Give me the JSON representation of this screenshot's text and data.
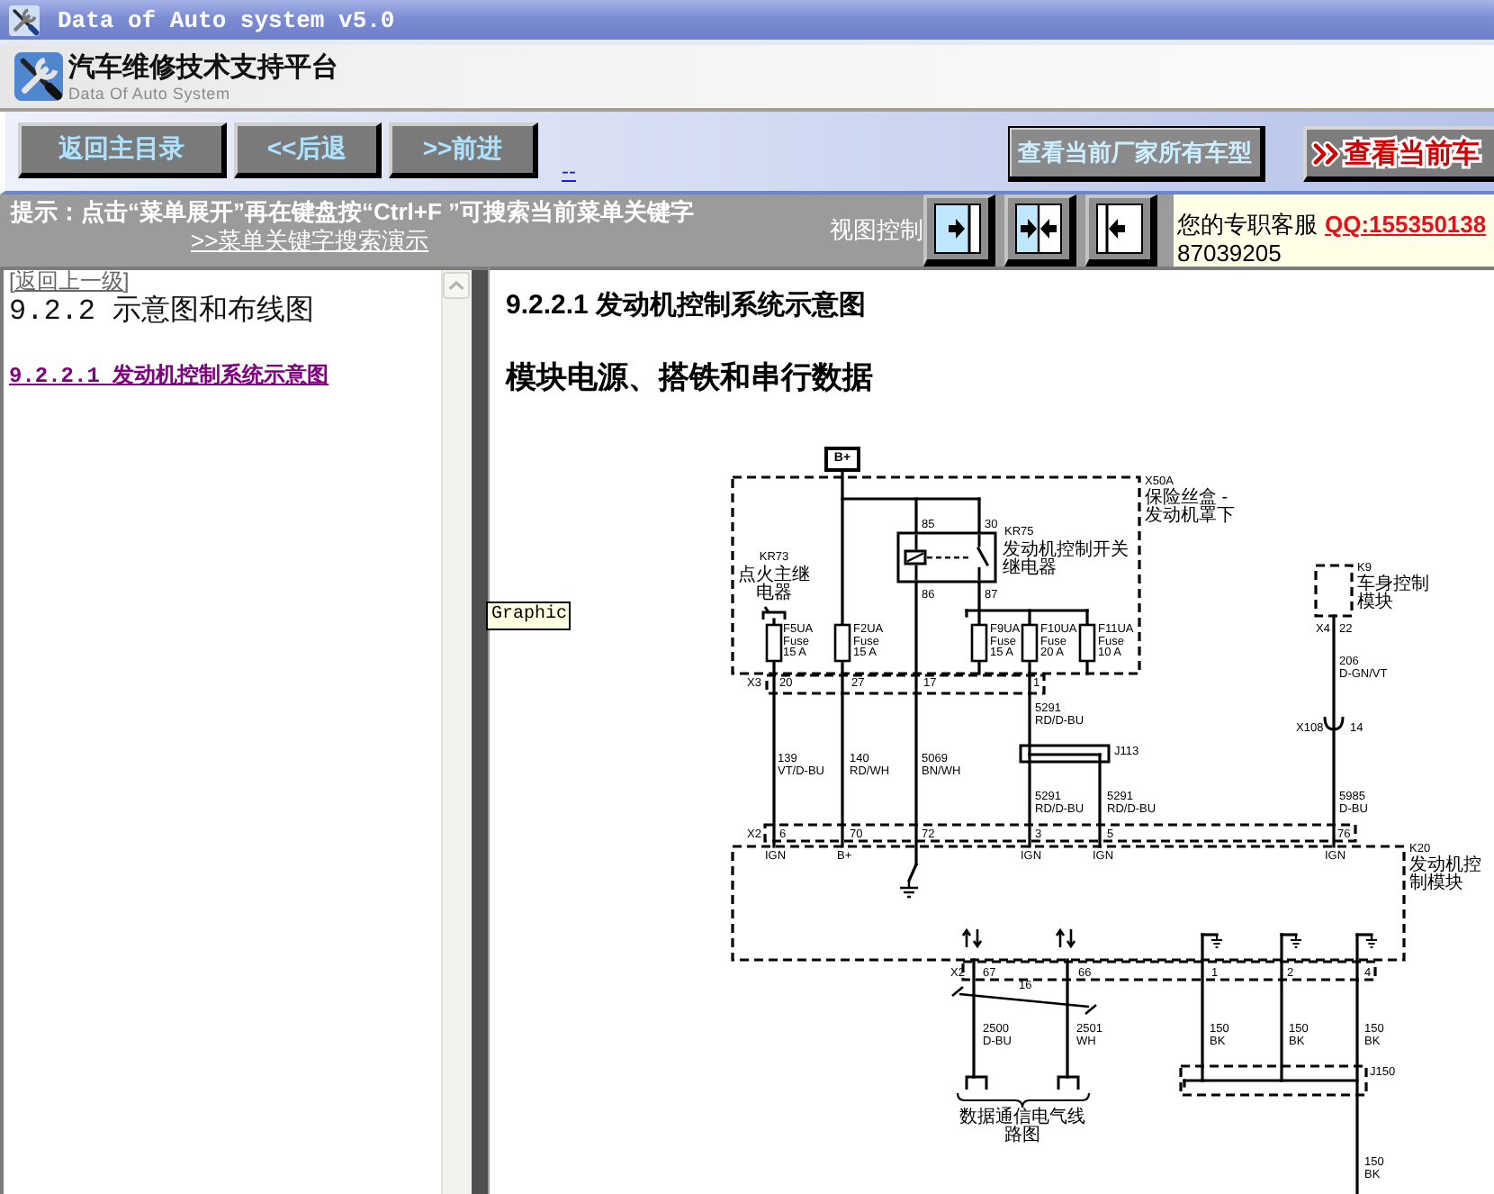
{
  "window": {
    "title": "Data of Auto system v5.0"
  },
  "header": {
    "title": "汽车维修技术支持平台",
    "subtitle": "Data Of Auto System"
  },
  "toolbar": {
    "buttons": [
      "返回主目录",
      "<<后退",
      ">>前进"
    ],
    "link": "--",
    "catalog_buttons": [
      {
        "label": "查看当前厂家所有车型",
        "kind": "plain"
      },
      {
        "label": "查看当前车",
        "kind": "highlight"
      }
    ]
  },
  "hint_bar": {
    "tip": "提示：点击“菜单展开”再在键盘按“Ctrl+F ”可搜索当前菜单关键字",
    "demo_link": ">>菜单关键字搜索演示",
    "view_label": "视图控制",
    "view_buttons": [
      {
        "kind": "right"
      },
      {
        "kind": "inward"
      },
      {
        "kind": "left"
      }
    ],
    "service_label": "您的专职客服",
    "qq": "QQ:155350138",
    "phone": "87039205"
  },
  "sidebar": {
    "back_link": "[返回上一级]",
    "heading": "9.2.2 示意图和布线图",
    "items": [
      {
        "label": "9.2.2.1 发动机控制系统示意图",
        "selected": true
      }
    ]
  },
  "content": {
    "title": "9.2.2.1 发动机控制系统示意图",
    "subtitle": "模块电源、搭铁和串行数据",
    "tooltip": "Graphic",
    "diagram": {
      "supply": "B+",
      "fuse_box": {
        "name": "X50A",
        "caption": "保险丝盒 - 发动机罩下"
      },
      "ignition_relay": {
        "name": "KR73",
        "caption": "点火主继电器"
      },
      "relay": {
        "name": "KR75",
        "caption": "发动机控制开关继电器",
        "pins": [
          "85",
          "30",
          "86",
          "87"
        ]
      },
      "fuses": [
        {
          "name": "F5UA",
          "type": "Fuse",
          "rating": "15 A"
        },
        {
          "name": "F2UA",
          "type": "Fuse",
          "rating": "15 A"
        },
        {
          "name": "F9UA",
          "type": "Fuse",
          "rating": "15 A"
        },
        {
          "name": "F10UA",
          "type": "Fuse",
          "rating": "20 A"
        },
        {
          "name": "F11UA",
          "type": "Fuse",
          "rating": "10 A"
        }
      ],
      "body_module": {
        "name": "K9",
        "caption": "车身控制模块",
        "connector": "X4",
        "pin": "22"
      },
      "inline_connector": {
        "name": "X108",
        "pin": "14"
      },
      "splices": [
        {
          "name": "J113"
        },
        {
          "name": "J150"
        }
      ],
      "connectors": [
        {
          "name": "X3",
          "pins": [
            "20",
            "27",
            "17",
            "1"
          ]
        },
        {
          "name": "X2",
          "pins": [
            "6",
            "70",
            "72",
            "3",
            "5",
            "76"
          ]
        },
        {
          "name": "X2",
          "pins": [
            "67",
            "66",
            "1",
            "2",
            "4"
          ]
        }
      ],
      "wires": [
        {
          "circuit": "5291",
          "code": "RD/D-BU"
        },
        {
          "circuit": "206",
          "code": "D-GN/VT"
        },
        {
          "circuit": "139",
          "code": "VT/D-BU"
        },
        {
          "circuit": "140",
          "code": "RD/WH"
        },
        {
          "circuit": "5069",
          "code": "BN/WH"
        },
        {
          "circuit": "5291",
          "code": "RD/D-BU"
        },
        {
          "circuit": "5291",
          "code": "RD/D-BU"
        },
        {
          "circuit": "5985",
          "code": "D-BU"
        },
        {
          "circuit": "2500",
          "code": "D-BU"
        },
        {
          "circuit": "2501",
          "code": "WH"
        },
        {
          "circuit": "150",
          "code": "BK"
        },
        {
          "circuit": "150",
          "code": "BK"
        },
        {
          "circuit": "150",
          "code": "BK"
        },
        {
          "circuit": "150",
          "code": "BK"
        }
      ],
      "module": {
        "name": "K20",
        "caption": "发动机控制模块",
        "terminals": [
          "IGN",
          "B+",
          "IGN",
          "IGN",
          "IGN"
        ]
      },
      "twisted_pair": "16",
      "bus_caption": "数据通信电气线路图"
    }
  }
}
